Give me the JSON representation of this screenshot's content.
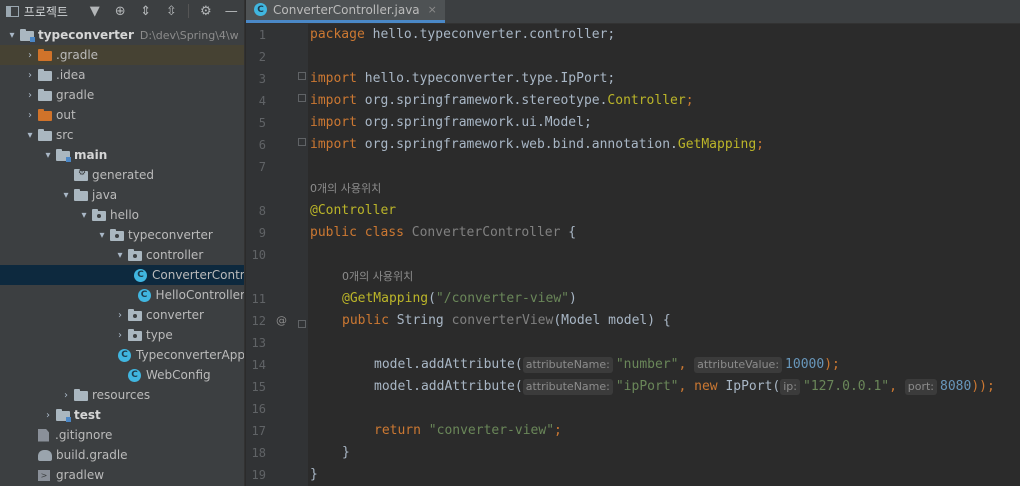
{
  "project_panel": {
    "title": "프로젝트",
    "tree": [
      {
        "label": "typeconverter",
        "path": "D:\\dev\\Spring\\4\\w",
        "depth": 0,
        "arrow": "down",
        "icon": "module-folder",
        "bold": true
      },
      {
        "label": ".gradle",
        "depth": 1,
        "arrow": "right",
        "icon": "orange-folder",
        "highlight": true
      },
      {
        "label": ".idea",
        "depth": 1,
        "arrow": "right",
        "icon": "folder"
      },
      {
        "label": "gradle",
        "depth": 1,
        "arrow": "right",
        "icon": "folder"
      },
      {
        "label": "out",
        "depth": 1,
        "arrow": "right",
        "icon": "orange-folder"
      },
      {
        "label": "src",
        "depth": 1,
        "arrow": "down",
        "icon": "folder"
      },
      {
        "label": "main",
        "depth": 2,
        "arrow": "down",
        "icon": "module-folder",
        "bold": true
      },
      {
        "label": "generated",
        "depth": 3,
        "arrow": "none",
        "icon": "generated-folder"
      },
      {
        "label": "java",
        "depth": 3,
        "arrow": "down",
        "icon": "source-folder"
      },
      {
        "label": "hello",
        "depth": 4,
        "arrow": "down",
        "icon": "package"
      },
      {
        "label": "typeconverter",
        "depth": 5,
        "arrow": "down",
        "icon": "package"
      },
      {
        "label": "controller",
        "depth": 6,
        "arrow": "down",
        "icon": "package"
      },
      {
        "label": "ConverterController",
        "depth": 7,
        "arrow": "none",
        "icon": "class",
        "selected": true
      },
      {
        "label": "HelloController",
        "depth": 7,
        "arrow": "none",
        "icon": "class"
      },
      {
        "label": "converter",
        "depth": 6,
        "arrow": "right",
        "icon": "package"
      },
      {
        "label": "type",
        "depth": 6,
        "arrow": "right",
        "icon": "package"
      },
      {
        "label": "TypeconverterApp",
        "depth": 6,
        "arrow": "none",
        "icon": "class-run"
      },
      {
        "label": "WebConfig",
        "depth": 6,
        "arrow": "none",
        "icon": "class"
      },
      {
        "label": "resources",
        "depth": 3,
        "arrow": "right",
        "icon": "resources-folder"
      },
      {
        "label": "test",
        "depth": 2,
        "arrow": "right",
        "icon": "module-folder",
        "bold": true
      },
      {
        "label": ".gitignore",
        "depth": 1,
        "arrow": "none",
        "icon": "file"
      },
      {
        "label": "build.gradle",
        "depth": 1,
        "arrow": "none",
        "icon": "gradle"
      },
      {
        "label": "gradlew",
        "depth": 1,
        "arrow": "none",
        "icon": "terminal"
      }
    ]
  },
  "editor": {
    "tab": {
      "label": "ConverterController.java",
      "close": "×"
    },
    "usage_text": "0개의 사용위치",
    "line_numbers": [
      "1",
      "2",
      "3",
      "4",
      "5",
      "6",
      "7",
      "8",
      "9",
      "10",
      "11",
      "12",
      "13",
      "14",
      "15",
      "16",
      "17",
      "18",
      "19"
    ],
    "code": {
      "l1_kw": "package",
      "l1_rest": " hello.typeconverter.controller;",
      "l3_kw": "import",
      "l3_rest": " hello.typeconverter.type.IpPort;",
      "l4_kw": "import",
      "l4_pre": " org.springframework.stereotype.",
      "l4_an": "Controller",
      "l4_end": ";",
      "l5_kw": "import",
      "l5_rest": " org.springframework.ui.Model;",
      "l6_kw": "import",
      "l6_pre": " org.springframework.web.bind.annotation.",
      "l6_an": "GetMapping",
      "l6_end": ";",
      "l8_an": "@Controller",
      "l9_kw": "public class",
      "l9_name": " ConverterController",
      "l9_end": " {",
      "l11_an": "@GetMapping",
      "l11_p1": "(",
      "l11_str": "\"/converter-view\"",
      "l11_p2": ")",
      "l12_kw": "public",
      "l12_type": " String",
      "l12_name": " converterView",
      "l12_rest": "(Model model) {",
      "l14_pre": "model.addAttribute(",
      "l14_h1": "attributeName:",
      "l14_s1": "\"number\"",
      "l14_c": ", ",
      "l14_h2": "attributeValue:",
      "l14_n": "10000",
      "l14_end": ");",
      "l15_pre": "model.addAttribute(",
      "l15_h1": "attributeName:",
      "l15_s1": "\"ipPort\"",
      "l15_c": ", ",
      "l15_kw": "new",
      "l15_cls": " IpPort(",
      "l15_h2": "ip:",
      "l15_s2": "\"127.0.0.1\"",
      "l15_c2": ", ",
      "l15_h3": "port:",
      "l15_n": "8080",
      "l15_end": "));",
      "l17_kw": "return",
      "l17_str": " \"converter-view\"",
      "l17_end": ";",
      "l18": "}",
      "l19": "}"
    },
    "gutter_at": "@"
  }
}
